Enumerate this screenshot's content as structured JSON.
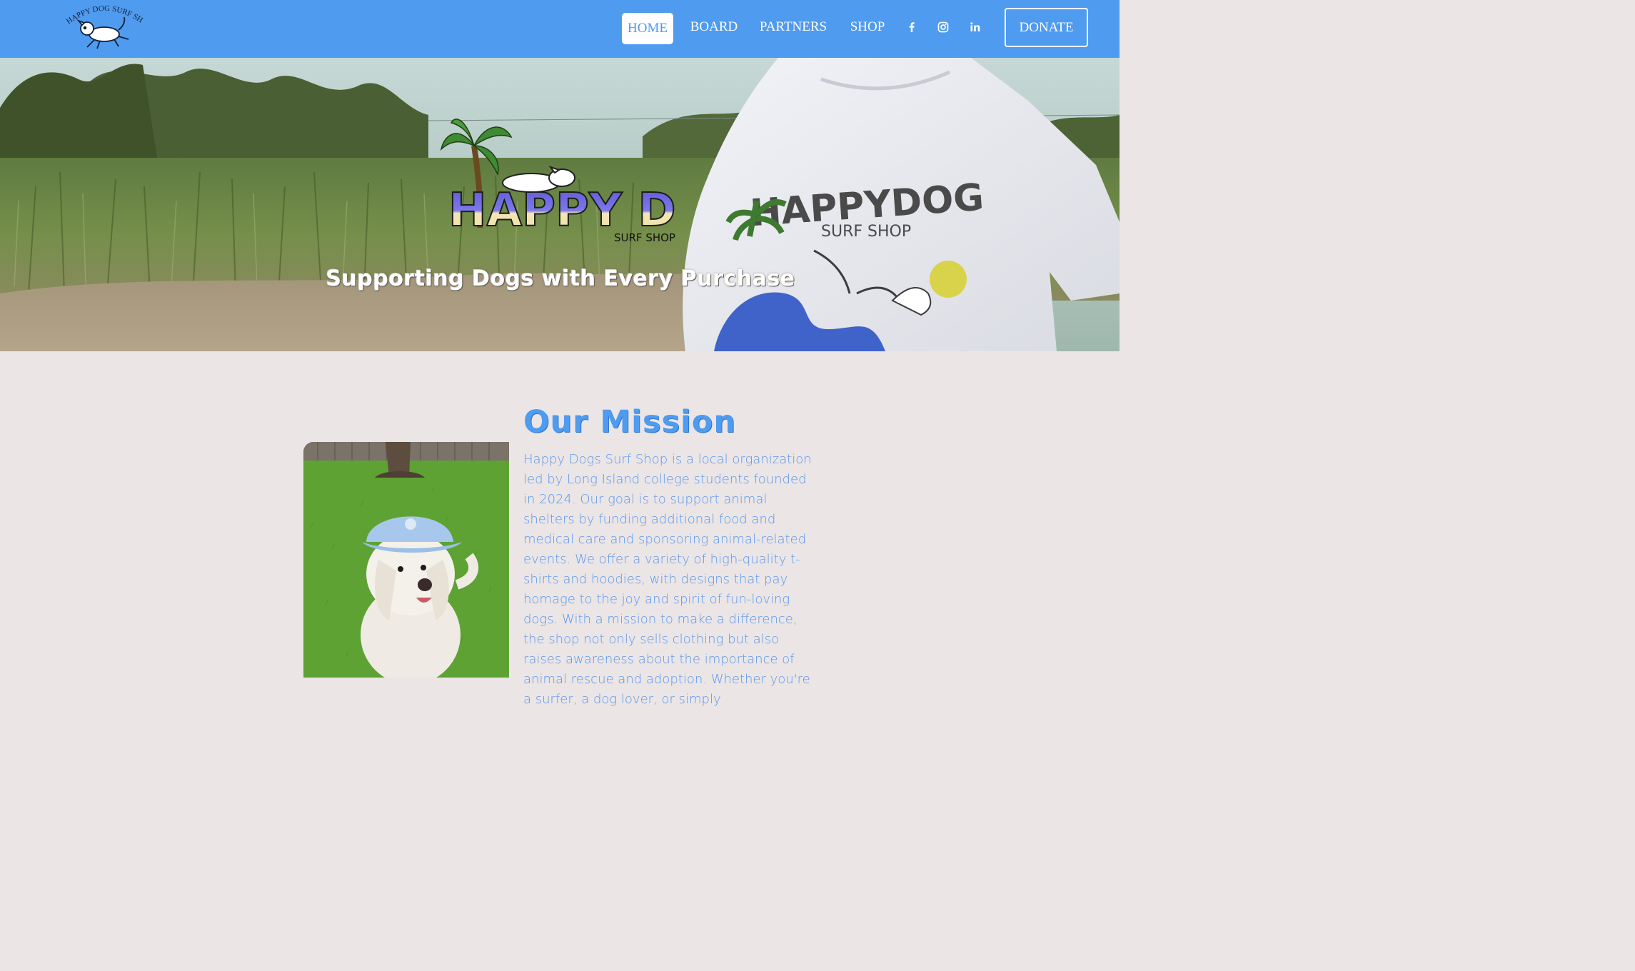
{
  "header": {
    "logo_text": "HAPPY DOG SURF SHOP",
    "nav": {
      "home": "HOME",
      "board": "BOARD",
      "partners": "PARTNERS",
      "shop": "SHOP"
    },
    "social_icons": [
      "facebook-icon",
      "instagram-icon",
      "linkedin-icon"
    ],
    "donate_label": "DONATE",
    "background_color": "#4f9bef"
  },
  "hero": {
    "logo_main": "HAPPY DOG",
    "logo_sub": "SURF SHOP",
    "shirt_print_main": "HAPPYDOG",
    "shirt_print_sub": "SURF SHOP",
    "tagline": "Supporting Dogs with Every Purchase"
  },
  "mission": {
    "title": "Our Mission",
    "body": "Happy Dogs Surf Shop is a local organization led by Long Island college students founded in 2024. Our goal is to support animal shelters by funding additional food and medical care and sponsoring animal-related events. We offer a variety of high-quality t-shirts and hoodies, with designs that pay homage to the joy and spirit of fun-loving dogs. With a mission to make a difference, the shop not only sells clothing but also raises awareness about the importance of animal rescue and adoption. Whether you're a surfer, a dog lover, or simply",
    "accent_color": "#4f9bef"
  }
}
